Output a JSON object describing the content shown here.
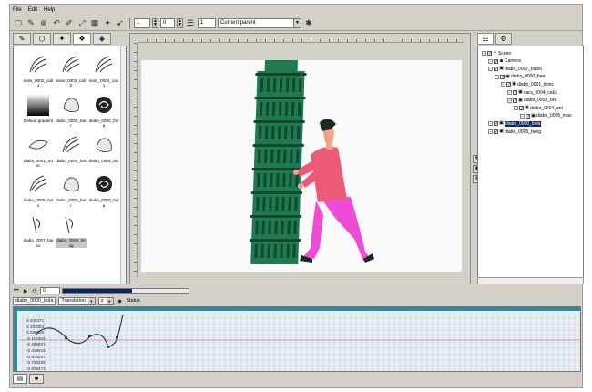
{
  "menu": [
    "File",
    "Edit",
    "Help"
  ],
  "toolbar": {
    "icons": [
      "new-icon",
      "open-icon",
      "save-icon",
      "undo-icon",
      "brush-icon",
      "transform-icon",
      "grid-icon",
      "paint-icon",
      "pointer-icon"
    ],
    "frame_value": "1",
    "step_value": "0",
    "count_value": "1",
    "parent_dropdown": "Current parent"
  },
  "library": {
    "items": [
      {
        "label": "sans_0002_cab1",
        "thumb": "sketch"
      },
      {
        "label": "sans_0003_cab2",
        "thumb": "sketch"
      },
      {
        "label": "sans_0004_cab1",
        "thumb": "sketch"
      },
      {
        "label": "Default gradient",
        "thumb": "gradient"
      },
      {
        "label": "diabo_0000_barr",
        "thumb": "shape"
      },
      {
        "label": "diabo_0000_bola",
        "thumb": "swirl"
      },
      {
        "label": "diabo_0001_tronc",
        "thumb": "leaf"
      },
      {
        "label": "diabo_0000_bra",
        "thumb": "sketch"
      },
      {
        "label": "diabo_0004_ant",
        "thumb": "shape"
      },
      {
        "label": "diabo_0005_mao",
        "thumb": "sketch"
      },
      {
        "label": "diabo_0000_barr",
        "thumb": "shape"
      },
      {
        "label": "diabo_0000_bola",
        "thumb": "swirl"
      },
      {
        "label": "diabo_0007_baixo",
        "thumb": "stick"
      },
      {
        "label": "diabo_0008_beng",
        "thumb": "stick"
      }
    ],
    "selected_index": 13
  },
  "tree": {
    "rows": [
      {
        "label": "Scene",
        "depth": 0,
        "icon": "scene-icon"
      },
      {
        "label": "Camera",
        "depth": 1,
        "icon": "camera-icon"
      },
      {
        "label": "diabo_0007_baixo",
        "depth": 1,
        "icon": "group-icon"
      },
      {
        "label": "diabo_0000_barr",
        "depth": 2,
        "icon": "group-icon"
      },
      {
        "label": "diabo_0001_tronc",
        "depth": 3,
        "icon": "group-icon"
      },
      {
        "label": "cara_0004_cab1",
        "depth": 4,
        "icon": "group-icon"
      },
      {
        "label": "diabo_0003_bra",
        "depth": 4,
        "icon": "group-icon"
      },
      {
        "label": "diabo_0004_ant",
        "depth": 5,
        "icon": "group-icon"
      },
      {
        "label": "diabo_0005_mao",
        "depth": 6,
        "icon": "group-icon"
      },
      {
        "label": "diabo_0000_bola",
        "depth": 1,
        "icon": "group-icon",
        "selected": true
      },
      {
        "label": "diabo_0008_beng",
        "depth": 1,
        "icon": "group-icon"
      }
    ]
  },
  "timeline": {
    "frame": "0",
    "progress": 0.55
  },
  "curve_editor": {
    "node": "diabo_0000_bola",
    "channel": "Translation",
    "axis": "x",
    "status_label": "Status",
    "values": [
      "0.346271",
      "0.193053",
      "0.039835",
      "-0.113383",
      "-0.266601",
      "-0.419819",
      "-0.573037",
      "-0.726255",
      "-0.879473",
      "-1.032691"
    ]
  },
  "colors": {
    "tower": "#1f7a52",
    "tower_dark": "#0f4a30",
    "shirt": "#ec5a78",
    "pants": "#f04bd6",
    "hair": "#1a2a22",
    "skin": "#f2a48a",
    "curve": "#2c3e66",
    "curve_teal": "#2e8c9c"
  }
}
